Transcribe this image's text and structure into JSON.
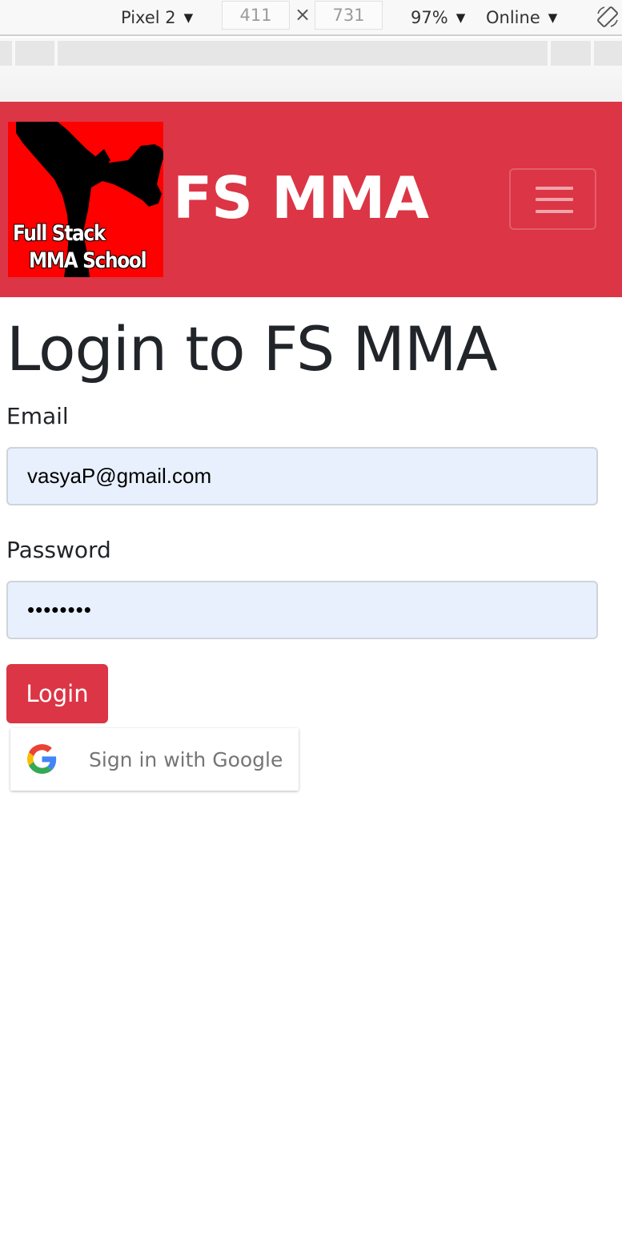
{
  "devtools": {
    "device": "Pixel 2",
    "width": "411",
    "times": "×",
    "height": "731",
    "zoom": "97%",
    "network": "Online",
    "caret": "▼"
  },
  "navbar": {
    "logo_line1": "Full Stack",
    "logo_line2": "MMA School",
    "brand": "FS MMA",
    "background": "#dc3545"
  },
  "form": {
    "title": "Login to FS MMA",
    "email_label": "Email",
    "email_value": "vasyaP@gmail.com",
    "password_label": "Password",
    "password_value": "••••••••",
    "login_label": "Login",
    "google_label": "Sign in with Google"
  },
  "icons": [
    "chevron-down-icon",
    "rotate-icon",
    "hamburger-icon",
    "google-icon"
  ]
}
